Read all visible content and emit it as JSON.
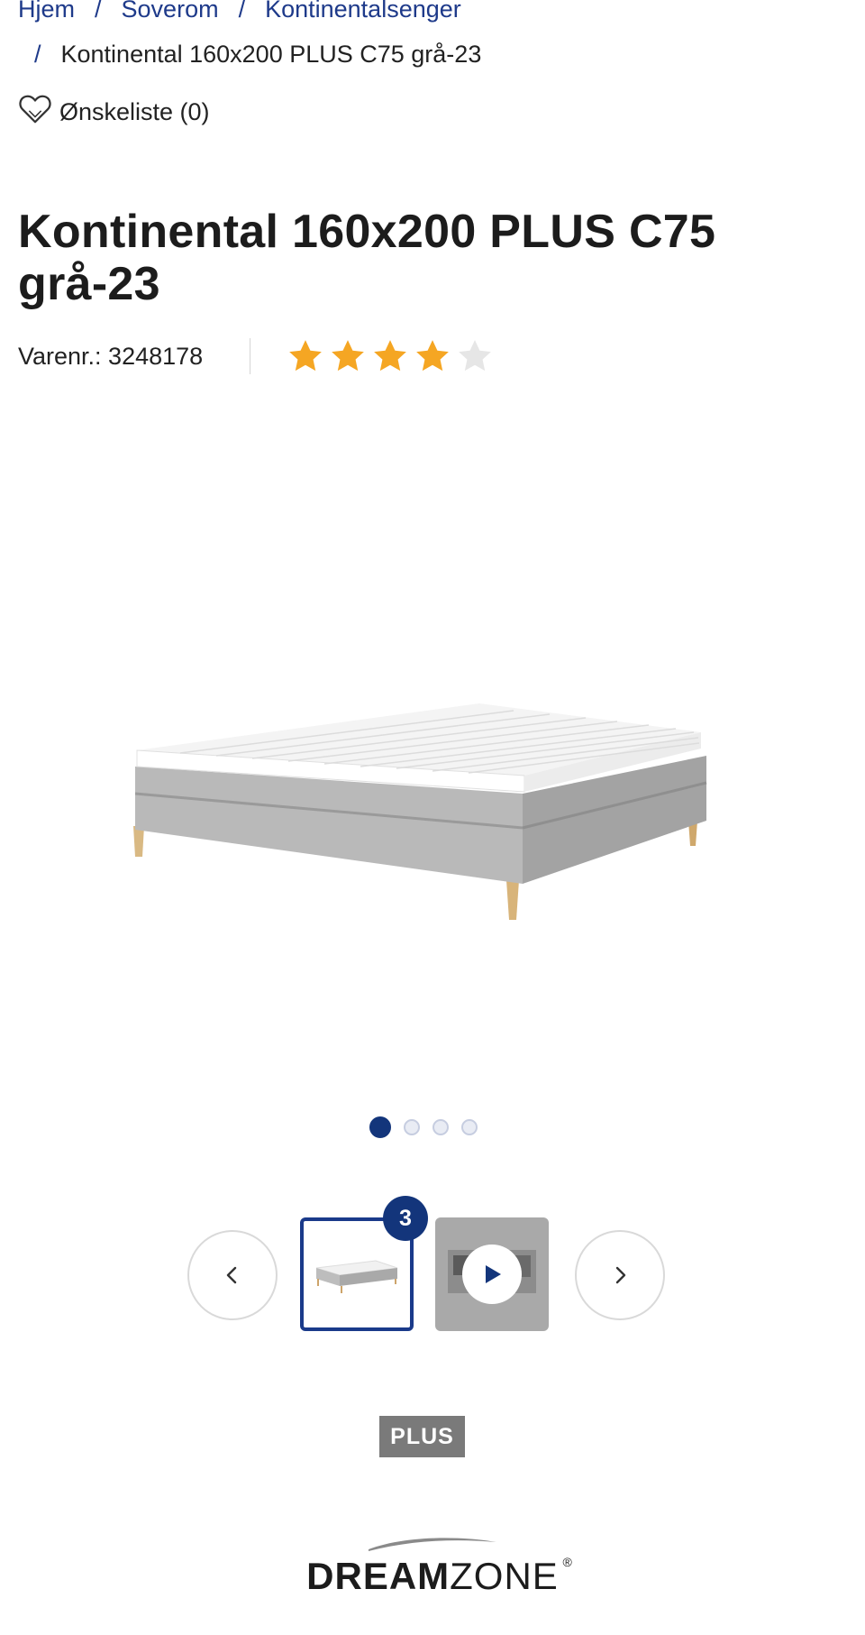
{
  "breadcrumb": {
    "items": [
      "Hjem",
      "Soverom",
      "Kontinentalsenger"
    ],
    "current": "Kontinental 160x200 PLUS C75 grå-23",
    "separator": "/"
  },
  "wishlist": {
    "label": "Ønskeliste (0)"
  },
  "product": {
    "title": "Kontinental 160x200 PLUS C75 grå-23",
    "sku_label": "Varenr.: 3248178",
    "rating": {
      "value": 4,
      "max": 5
    }
  },
  "gallery": {
    "image_count": 4,
    "active_index": 0,
    "thumb_badge": "3",
    "prev_icon": "chevron-left-icon",
    "next_icon": "chevron-right-icon"
  },
  "tag": {
    "label": "PLUS"
  },
  "brand": {
    "name_bold": "DREAM",
    "name_light": "ZONE",
    "registered": "®"
  },
  "colors": {
    "link": "#1e3a8a",
    "accent": "#13357b",
    "star": "#f5a623",
    "star_empty": "#e6e6e6",
    "tag_bg": "#7a7a7a"
  }
}
